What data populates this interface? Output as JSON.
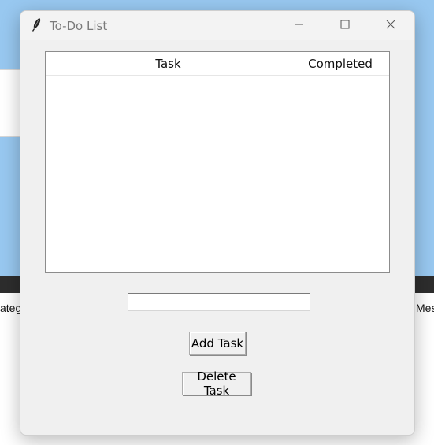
{
  "background": {
    "left_text": "ateg",
    "right_text": "Mes"
  },
  "window": {
    "title": "To-Do List",
    "icon": "feather-icon",
    "controls": {
      "minimize": "minimize-icon",
      "maximize": "maximize-icon",
      "close": "close-icon"
    }
  },
  "tree": {
    "columns": [
      "Task",
      "Completed"
    ],
    "rows": []
  },
  "entry": {
    "value": ""
  },
  "buttons": {
    "add": "Add Task",
    "delete": "Delete Task"
  },
  "colors": {
    "desktop": "#98c8f0",
    "window_bg": "#f0f0f0",
    "strip": "#2d2d2d"
  }
}
